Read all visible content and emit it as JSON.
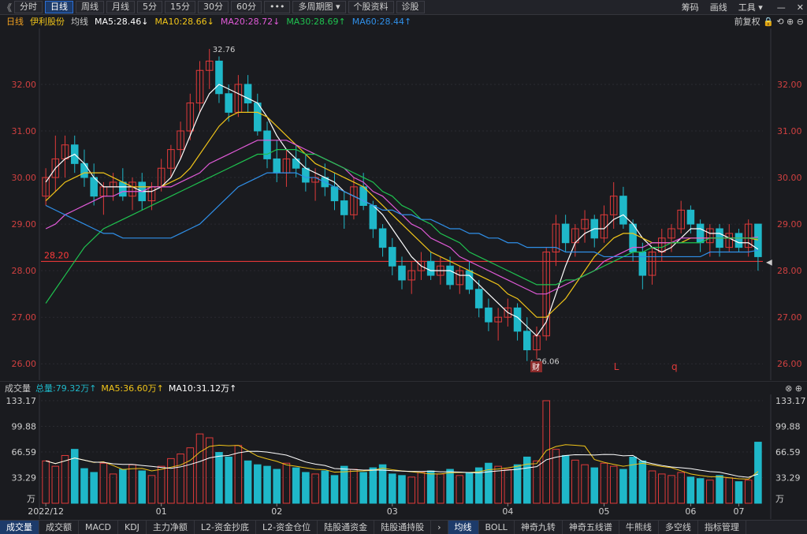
{
  "toolbar": {
    "back": "《",
    "tabs": [
      "分时",
      "日线",
      "周线",
      "月线",
      "5分",
      "15分",
      "30分",
      "60分",
      "•••",
      "多周期图 ▾",
      "个股资料",
      "诊股"
    ],
    "active_tab": 1,
    "right": [
      "筹码",
      "画线",
      "工具 ▾"
    ],
    "window_icons": [
      "minimize-icon",
      "close-icon"
    ]
  },
  "ma_bar": {
    "period": "日线",
    "name": "伊利股份",
    "label": "均线",
    "ma5": "MA5:28.46↓",
    "ma10": "MA10:28.66↓",
    "ma20": "MA20:28.72↓",
    "ma30": "MA30:28.69↑",
    "ma60": "MA60:28.44↑",
    "right": "前复权"
  },
  "colors": {
    "up": "#e03a3a",
    "down": "#1fb8c9",
    "ma5": "#ffffff",
    "ma10": "#f0c419",
    "ma20": "#e05ad7",
    "ma30": "#1fc24f",
    "ma60": "#2f8fe8",
    "ref": "#ff3b3b"
  },
  "vol_bar": {
    "title": "成交量",
    "total": "总量:79.32万↑",
    "ma5": "MA5:36.60万↑",
    "ma10": "MA10:31.12万↑"
  },
  "bottom_tabs": [
    "成交量",
    "成交额",
    "MACD",
    "KDJ",
    "主力净额",
    "L2-资金抄底",
    "L2-资金仓位",
    "陆股通资金",
    "陆股通持股",
    "›",
    "均线",
    "BOLL",
    "神奇九转",
    "神奇五线谱",
    "牛熊线",
    "多空线",
    "指标管理"
  ],
  "chart_data": {
    "type": "candlestick",
    "y_ticks": [
      "32.00",
      "31.00",
      "30.00",
      "29.00",
      "28.00",
      "27.00",
      "26.00"
    ],
    "ylim": [
      25.75,
      33.1
    ],
    "ref_line": "28.20",
    "annotations": {
      "high": "32.76",
      "low": "←26.06",
      "marker_cai": "财",
      "marker_L": "L",
      "marker_q": "q"
    },
    "x_labels": [
      "2022/12",
      "01",
      "02",
      "03",
      "04",
      "05",
      "06",
      "07"
    ],
    "vol_ticks": [
      "133.17",
      "99.88",
      "66.59",
      "33.29",
      "万"
    ],
    "vol_ylim": [
      0,
      133.17
    ],
    "candles": [
      [
        29.6,
        30.2,
        29.4,
        30.0
      ],
      [
        30.0,
        30.9,
        29.7,
        30.4
      ],
      [
        30.4,
        30.9,
        30.0,
        30.7
      ],
      [
        30.7,
        30.9,
        30.1,
        30.3
      ],
      [
        30.3,
        30.6,
        29.8,
        30.0
      ],
      [
        30.0,
        30.3,
        29.4,
        29.6
      ],
      [
        29.6,
        29.9,
        29.2,
        29.8
      ],
      [
        29.8,
        30.1,
        29.5,
        29.9
      ],
      [
        29.9,
        30.2,
        29.5,
        29.6
      ],
      [
        29.6,
        30.0,
        29.3,
        29.9
      ],
      [
        29.9,
        30.1,
        29.3,
        29.5
      ],
      [
        29.5,
        29.9,
        29.3,
        29.8
      ],
      [
        29.8,
        30.4,
        29.7,
        30.2
      ],
      [
        30.2,
        30.7,
        30.0,
        30.6
      ],
      [
        30.6,
        31.2,
        30.4,
        31.0
      ],
      [
        31.0,
        31.8,
        30.8,
        31.6
      ],
      [
        31.6,
        32.5,
        31.4,
        32.3
      ],
      [
        32.3,
        32.76,
        31.9,
        32.5
      ],
      [
        32.5,
        32.6,
        31.6,
        31.8
      ],
      [
        31.8,
        32.0,
        31.2,
        31.4
      ],
      [
        31.4,
        32.2,
        31.3,
        32.0
      ],
      [
        32.0,
        32.2,
        31.4,
        31.6
      ],
      [
        31.6,
        31.8,
        30.9,
        31.0
      ],
      [
        31.0,
        31.2,
        30.2,
        30.4
      ],
      [
        30.4,
        30.8,
        29.9,
        30.1
      ],
      [
        30.1,
        30.6,
        29.8,
        30.4
      ],
      [
        30.4,
        30.7,
        30.0,
        30.2
      ],
      [
        30.2,
        30.5,
        29.7,
        29.9
      ],
      [
        29.9,
        30.2,
        29.5,
        30.0
      ],
      [
        30.0,
        30.3,
        29.6,
        29.8
      ],
      [
        29.8,
        30.1,
        29.3,
        29.5
      ],
      [
        29.5,
        29.7,
        28.9,
        29.2
      ],
      [
        29.2,
        30.0,
        29.1,
        29.8
      ],
      [
        29.8,
        30.1,
        29.3,
        29.4
      ],
      [
        29.4,
        29.5,
        28.7,
        28.9
      ],
      [
        28.9,
        29.0,
        28.3,
        28.5
      ],
      [
        28.5,
        28.7,
        27.9,
        28.1
      ],
      [
        28.1,
        28.3,
        27.6,
        27.8
      ],
      [
        27.8,
        28.2,
        27.5,
        28.0
      ],
      [
        28.0,
        28.4,
        27.8,
        28.2
      ],
      [
        28.2,
        28.4,
        27.8,
        27.9
      ],
      [
        27.9,
        28.3,
        27.7,
        28.1
      ],
      [
        28.1,
        28.3,
        27.6,
        27.7
      ],
      [
        27.7,
        28.1,
        27.5,
        28.0
      ],
      [
        28.0,
        28.2,
        27.5,
        27.6
      ],
      [
        27.6,
        27.8,
        27.0,
        27.2
      ],
      [
        27.2,
        27.4,
        26.7,
        26.9
      ],
      [
        26.9,
        27.2,
        26.5,
        27.0
      ],
      [
        27.0,
        27.4,
        26.8,
        27.2
      ],
      [
        27.2,
        27.3,
        26.5,
        26.7
      ],
      [
        26.7,
        27.0,
        26.06,
        26.3
      ],
      [
        26.3,
        26.8,
        26.1,
        26.6
      ],
      [
        26.6,
        28.5,
        26.5,
        28.4
      ],
      [
        28.4,
        29.2,
        28.1,
        29.0
      ],
      [
        29.0,
        29.2,
        28.4,
        28.6
      ],
      [
        28.6,
        29.0,
        28.3,
        28.9
      ],
      [
        28.9,
        29.3,
        28.6,
        29.1
      ],
      [
        29.1,
        29.2,
        28.5,
        28.7
      ],
      [
        28.7,
        29.4,
        28.6,
        29.2
      ],
      [
        29.2,
        29.9,
        28.9,
        29.6
      ],
      [
        29.6,
        29.8,
        28.9,
        29.0
      ],
      [
        29.0,
        29.1,
        28.2,
        28.4
      ],
      [
        28.4,
        28.6,
        27.6,
        27.9
      ],
      [
        27.9,
        28.5,
        27.7,
        28.4
      ],
      [
        28.4,
        28.9,
        28.2,
        28.7
      ],
      [
        28.7,
        29.0,
        28.4,
        28.9
      ],
      [
        28.9,
        29.5,
        28.8,
        29.3
      ],
      [
        29.3,
        29.4,
        28.8,
        29.0
      ],
      [
        29.0,
        29.1,
        28.4,
        28.6
      ],
      [
        28.6,
        29.0,
        28.3,
        28.9
      ],
      [
        28.9,
        29.0,
        28.3,
        28.5
      ],
      [
        28.5,
        29.0,
        28.4,
        28.8
      ],
      [
        28.8,
        28.9,
        28.4,
        28.5
      ],
      [
        28.5,
        29.1,
        28.3,
        29.0
      ],
      [
        29.0,
        28.9,
        28.0,
        28.3
      ]
    ],
    "volumes": [
      55,
      48,
      62,
      70,
      45,
      40,
      52,
      38,
      44,
      50,
      42,
      36,
      48,
      58,
      64,
      72,
      90,
      85,
      66,
      60,
      75,
      55,
      50,
      48,
      44,
      52,
      46,
      40,
      38,
      42,
      36,
      48,
      44,
      40,
      46,
      50,
      38,
      36,
      34,
      40,
      42,
      38,
      44,
      36,
      40,
      46,
      52,
      48,
      44,
      50,
      60,
      55,
      133.17,
      70,
      62,
      56,
      50,
      46,
      52,
      48,
      44,
      60,
      55,
      42,
      38,
      36,
      40,
      34,
      32,
      30,
      36,
      33,
      28,
      30,
      79.32
    ],
    "ma_lines": {
      "ma5": [
        29.9,
        30.2,
        30.4,
        30.5,
        30.3,
        30.0,
        29.8,
        29.8,
        29.8,
        29.8,
        29.7,
        29.7,
        29.8,
        30.0,
        30.4,
        30.9,
        31.4,
        31.8,
        32.0,
        31.9,
        31.8,
        31.7,
        31.6,
        31.3,
        30.9,
        30.6,
        30.4,
        30.2,
        30.1,
        30.0,
        29.9,
        29.7,
        29.6,
        29.5,
        29.4,
        29.2,
        28.9,
        28.6,
        28.3,
        28.1,
        28.0,
        28.0,
        28.0,
        27.9,
        27.9,
        27.7,
        27.5,
        27.3,
        27.1,
        27.0,
        26.8,
        26.6,
        26.9,
        27.5,
        28.1,
        28.6,
        28.8,
        28.9,
        28.9,
        29.1,
        29.2,
        29.0,
        28.7,
        28.5,
        28.4,
        28.5,
        28.7,
        28.9,
        28.9,
        28.8,
        28.8,
        28.7,
        28.6,
        28.6,
        28.46
      ],
      "ma10": [
        29.5,
        29.7,
        29.9,
        30.0,
        30.1,
        30.1,
        30.1,
        30.0,
        29.9,
        29.8,
        29.8,
        29.8,
        29.8,
        29.9,
        30.0,
        30.2,
        30.5,
        30.8,
        31.1,
        31.3,
        31.4,
        31.4,
        31.4,
        31.3,
        31.1,
        30.9,
        30.7,
        30.5,
        30.3,
        30.2,
        30.1,
        30.0,
        29.9,
        29.8,
        29.6,
        29.4,
        29.2,
        29.0,
        28.8,
        28.6,
        28.4,
        28.3,
        28.2,
        28.1,
        28.0,
        27.9,
        27.8,
        27.7,
        27.5,
        27.4,
        27.2,
        27.0,
        27.0,
        27.2,
        27.4,
        27.7,
        28.0,
        28.3,
        28.5,
        28.7,
        28.8,
        28.8,
        28.7,
        28.6,
        28.6,
        28.6,
        28.6,
        28.7,
        28.7,
        28.7,
        28.7,
        28.7,
        28.7,
        28.7,
        28.66
      ],
      "ma20": [
        28.9,
        29.0,
        29.2,
        29.3,
        29.4,
        29.5,
        29.6,
        29.6,
        29.7,
        29.7,
        29.7,
        29.8,
        29.8,
        29.8,
        29.9,
        30.0,
        30.1,
        30.3,
        30.4,
        30.5,
        30.6,
        30.7,
        30.8,
        30.8,
        30.8,
        30.8,
        30.7,
        30.6,
        30.5,
        30.4,
        30.3,
        30.2,
        30.0,
        29.9,
        29.7,
        29.6,
        29.4,
        29.2,
        29.0,
        28.9,
        28.7,
        28.6,
        28.5,
        28.3,
        28.2,
        28.1,
        28.0,
        27.9,
        27.8,
        27.7,
        27.6,
        27.5,
        27.5,
        27.6,
        27.7,
        27.8,
        27.9,
        28.0,
        28.2,
        28.3,
        28.4,
        28.5,
        28.5,
        28.6,
        28.6,
        28.6,
        28.7,
        28.7,
        28.7,
        28.7,
        28.7,
        28.7,
        28.7,
        28.7,
        28.72
      ],
      "ma30": [
        27.3,
        27.6,
        27.9,
        28.2,
        28.5,
        28.7,
        28.9,
        29.0,
        29.1,
        29.2,
        29.3,
        29.4,
        29.5,
        29.6,
        29.7,
        29.8,
        29.9,
        30.0,
        30.1,
        30.2,
        30.3,
        30.4,
        30.5,
        30.5,
        30.6,
        30.6,
        30.6,
        30.5,
        30.5,
        30.4,
        30.3,
        30.2,
        30.1,
        30.0,
        29.9,
        29.7,
        29.6,
        29.4,
        29.3,
        29.1,
        29.0,
        28.8,
        28.7,
        28.6,
        28.4,
        28.3,
        28.2,
        28.1,
        28.0,
        27.9,
        27.8,
        27.7,
        27.7,
        27.7,
        27.8,
        27.8,
        27.9,
        28.0,
        28.1,
        28.2,
        28.3,
        28.4,
        28.4,
        28.5,
        28.5,
        28.6,
        28.6,
        28.6,
        28.6,
        28.7,
        28.7,
        28.7,
        28.7,
        28.7,
        28.69
      ],
      "ma60": [
        29.4,
        29.3,
        29.2,
        29.1,
        29.0,
        28.9,
        28.8,
        28.8,
        28.7,
        28.7,
        28.7,
        28.7,
        28.7,
        28.7,
        28.8,
        28.9,
        29.0,
        29.2,
        29.4,
        29.6,
        29.8,
        29.9,
        30.0,
        30.1,
        30.1,
        30.1,
        30.1,
        30.0,
        30.0,
        29.9,
        29.8,
        29.7,
        29.6,
        29.5,
        29.4,
        29.3,
        29.3,
        29.2,
        29.2,
        29.1,
        29.1,
        29.0,
        28.9,
        28.9,
        28.8,
        28.8,
        28.7,
        28.7,
        28.6,
        28.6,
        28.5,
        28.5,
        28.5,
        28.5,
        28.4,
        28.4,
        28.4,
        28.4,
        28.3,
        28.3,
        28.3,
        28.3,
        28.3,
        28.3,
        28.3,
        28.3,
        28.3,
        28.3,
        28.3,
        28.4,
        28.4,
        28.4,
        28.4,
        28.4,
        28.44
      ]
    }
  }
}
